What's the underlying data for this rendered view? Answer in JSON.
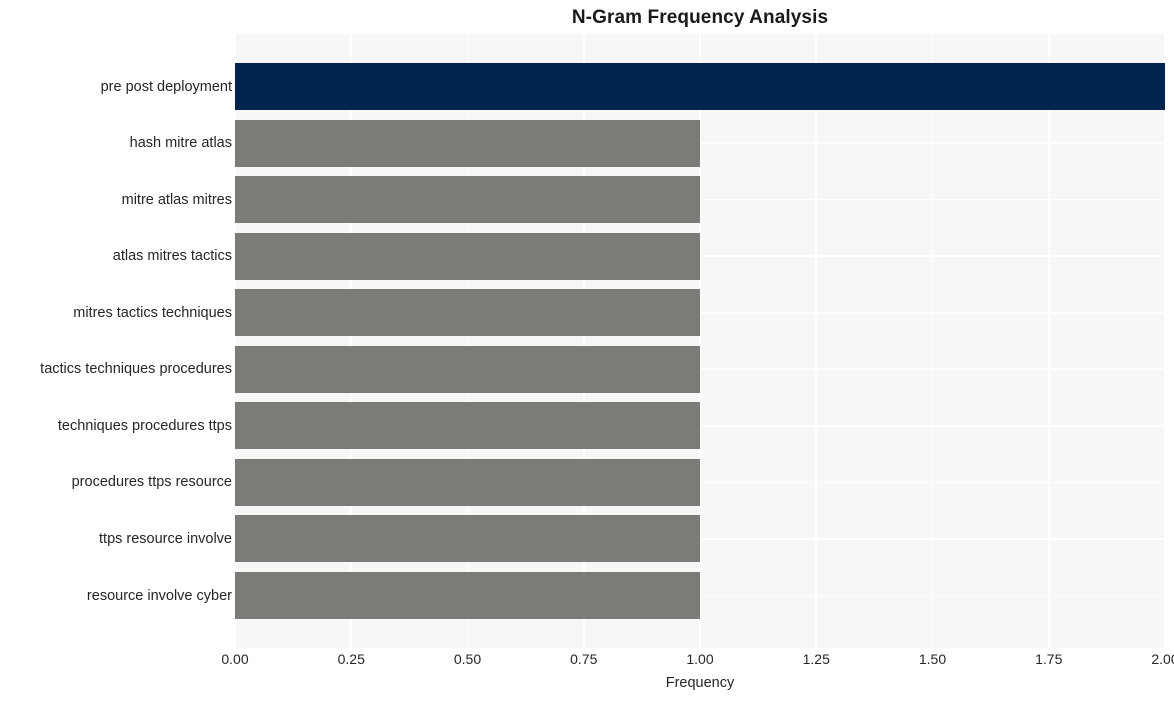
{
  "chart_data": {
    "type": "bar",
    "orientation": "horizontal",
    "title": "N-Gram Frequency Analysis",
    "xlabel": "Frequency",
    "ylabel": "",
    "xlim": [
      0,
      2.0
    ],
    "xticks": [
      "0.00",
      "0.25",
      "0.50",
      "0.75",
      "1.00",
      "1.25",
      "1.50",
      "1.75",
      "2.00"
    ],
    "xtick_values": [
      0,
      0.25,
      0.5,
      0.75,
      1.0,
      1.25,
      1.5,
      1.75,
      2.0
    ],
    "grid": true,
    "legend": "none",
    "categories": [
      "pre post deployment",
      "hash mitre atlas",
      "mitre atlas mitres",
      "atlas mitres tactics",
      "mitres tactics techniques",
      "tactics techniques procedures",
      "techniques procedures ttps",
      "procedures ttps resource",
      "ttps resource involve",
      "resource involve cyber"
    ],
    "values": [
      2,
      1,
      1,
      1,
      1,
      1,
      1,
      1,
      1,
      1
    ],
    "bar_colors": [
      "#002450",
      "#7c7b78",
      "#7c7b78",
      "#7c7b78",
      "#7c7b78",
      "#7c7b78",
      "#7c7b78",
      "#7c7b78",
      "#7c7b78",
      "#7c7b78"
    ]
  },
  "style": {
    "figure_background": "#ffffff",
    "plot_background": "#f7f7f7",
    "gridline_color": "#ffffff",
    "highlight_color": "#002450",
    "default_bar_color": "#7c7b78",
    "text_color": "#262626"
  }
}
